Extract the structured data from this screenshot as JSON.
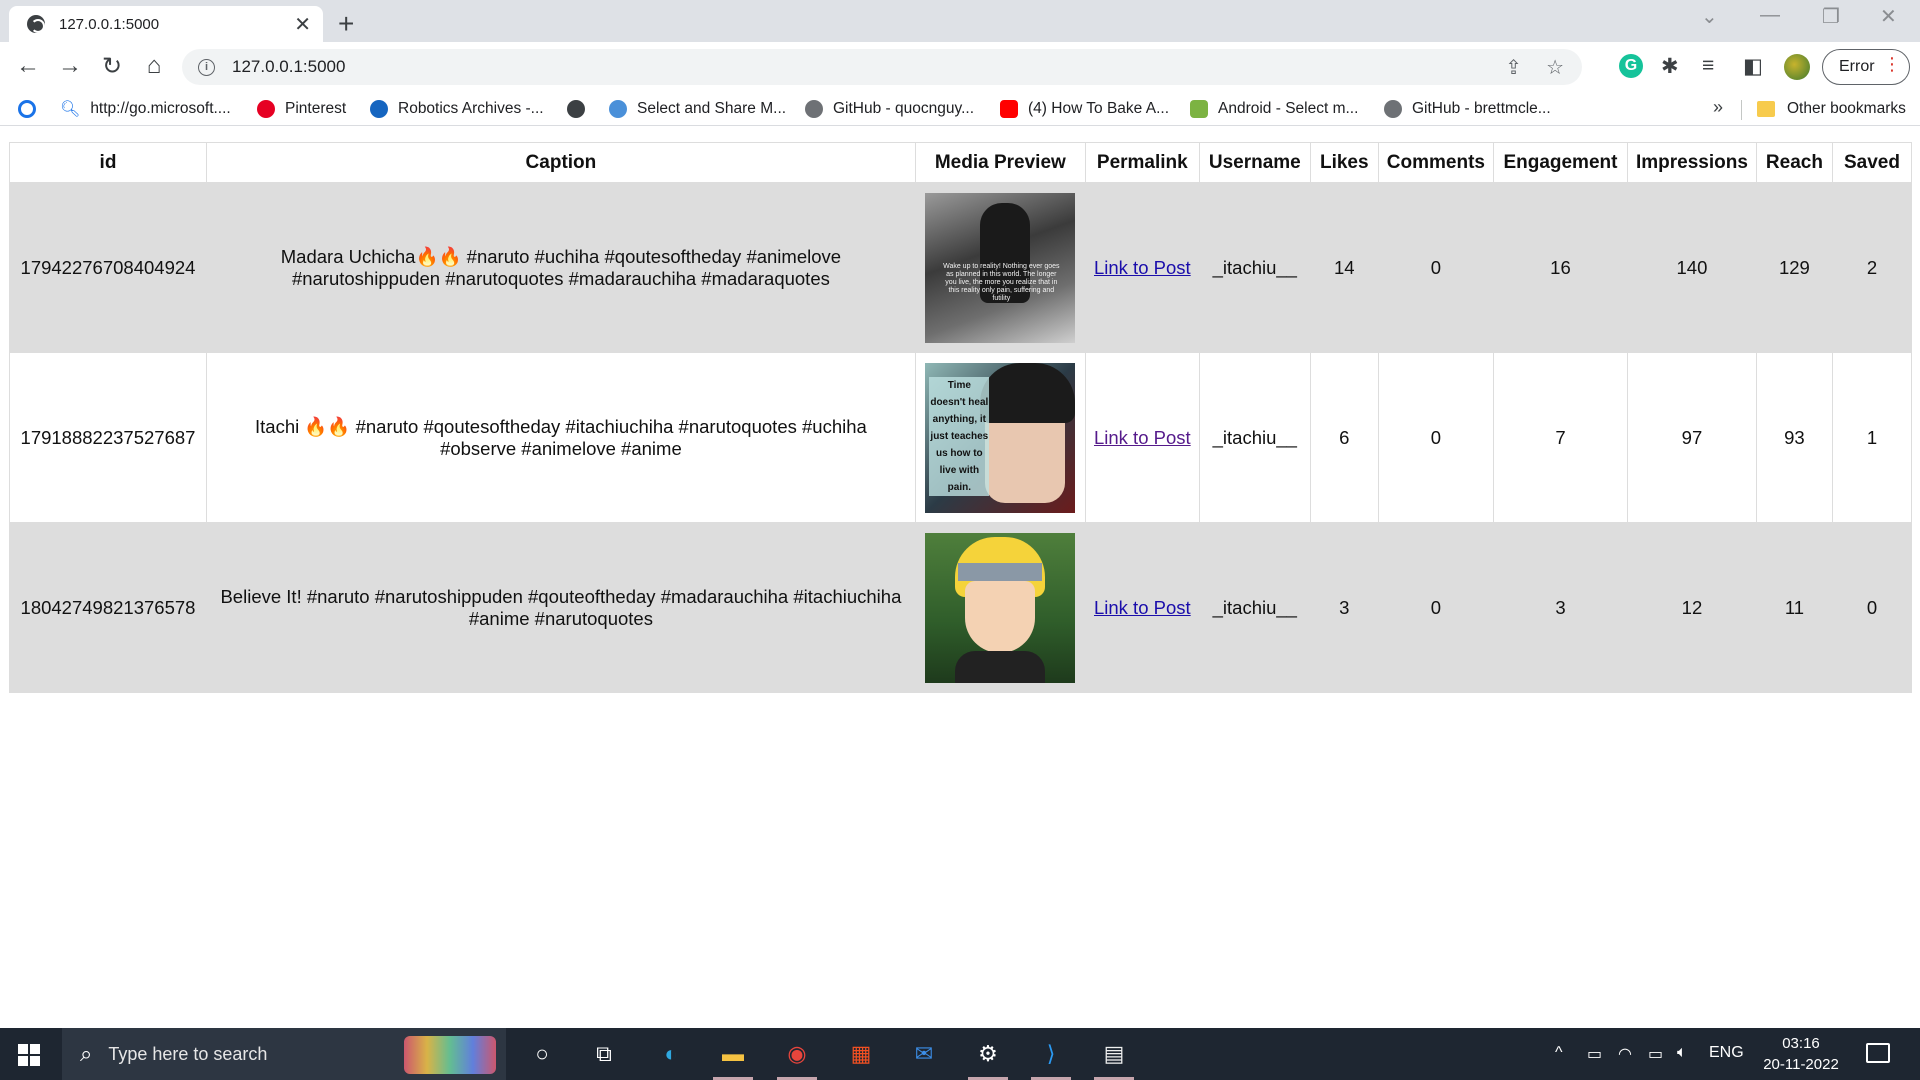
{
  "browser": {
    "tab_title": "127.0.0.1:5000",
    "url": "127.0.0.1:5000",
    "profile_button": "Error"
  },
  "bookmarks": [
    {
      "label": "",
      "icon": "chrome-extension-icon",
      "color": "#1a73e8"
    },
    {
      "label": "http://go.microsoft....",
      "icon": "search-icon",
      "color": "#1a73e8"
    },
    {
      "label": "Pinterest",
      "icon": "pinterest-icon",
      "color": "#e60023"
    },
    {
      "label": "Robotics Archives -...",
      "icon": "robotics-icon",
      "color": "#1565c0"
    },
    {
      "label": "",
      "icon": "globe-icon",
      "color": "#3c4043"
    },
    {
      "label": "Select and Share M...",
      "icon": "gear-icon",
      "color": "#4a90d9"
    },
    {
      "label": "GitHub - quocnguy...",
      "icon": "github-icon",
      "color": "#3c4043"
    },
    {
      "label": "(4) How To Bake A...",
      "icon": "youtube-icon",
      "color": "#ff0000"
    },
    {
      "label": "Android - Select m...",
      "icon": "android-icon",
      "color": "#7cb342"
    },
    {
      "label": "GitHub - brettmcle...",
      "icon": "github-icon",
      "color": "#3c4043"
    }
  ],
  "other_bookmarks": "Other bookmarks",
  "table": {
    "headers": [
      "id",
      "Caption",
      "Media Preview",
      "Permalink",
      "Username",
      "Likes",
      "Comments",
      "Engagement",
      "Impressions",
      "Reach",
      "Saved"
    ],
    "rows": [
      {
        "id": "17942276708404924",
        "caption": "Madara Uchicha🔥🔥 #naruto #uchiha #qoutesoftheday #animelove #narutoshippuden #narutoquotes #madarauchiha #madaraquotes",
        "media_text": "Wake up to reality! Nothing ever goes as planned in this world. The longer you live, the more you realize that in this reality only pain, suffering and futility",
        "permalink": "Link to Post",
        "username": "_itachiu__",
        "likes": "14",
        "comments": "0",
        "engagement": "16",
        "impressions": "140",
        "reach": "129",
        "saved": "2"
      },
      {
        "id": "17918882237527687",
        "caption": "Itachi 🔥🔥 #naruto #qoutesoftheday #itachiuchiha #narutoquotes #uchiha #observe #animelove #anime",
        "media_text": "Time doesn't heal anything, it just teaches us how to live with pain.",
        "permalink": "Link to Post",
        "username": "_itachiu__",
        "likes": "6",
        "comments": "0",
        "engagement": "7",
        "impressions": "97",
        "reach": "93",
        "saved": "1"
      },
      {
        "id": "18042749821376578",
        "caption": "Believe It! #naruto #narutoshippuden #qouteoftheday #madarauchiha #itachiuchiha #anime #narutoquotes",
        "media_text": "",
        "permalink": "Link to Post",
        "username": "_itachiu__",
        "likes": "3",
        "comments": "0",
        "engagement": "3",
        "impressions": "12",
        "reach": "11",
        "saved": "0"
      }
    ]
  },
  "taskbar": {
    "search_placeholder": "Type here to search",
    "language": "ENG",
    "time": "03:16",
    "date": "20-11-2022"
  }
}
